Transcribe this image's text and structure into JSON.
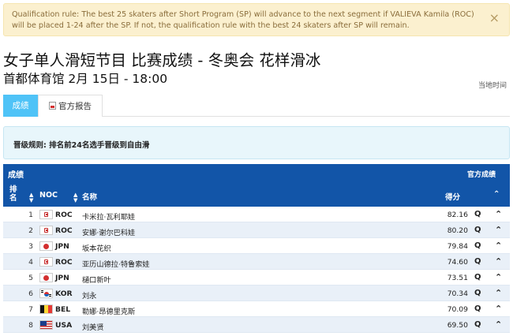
{
  "alert": {
    "text": "Qualification rule: The best 25 skaters after Short Program (SP) will advance to the next segment if VALIEVA Kamila (ROC) will be placed 1-24 after the SP. If not, the qualification rule with the best 24 skaters after SP will remain.",
    "close_label": "×"
  },
  "page": {
    "title": "女子单人滑短节目 比赛成绩 - 冬奥会 花样滑冰",
    "subtitle": "首都体育馆 2月 15日 - 18:00",
    "local_time": "当地时间"
  },
  "tabs": [
    {
      "label": "成绩",
      "active": true
    },
    {
      "label": "官方报告",
      "active": false
    }
  ],
  "qualification": {
    "text": "晋级规则: 排名前24名选手晋级到自由滑"
  },
  "results": {
    "section_title": "成绩",
    "official_report": "官方成绩",
    "columns": {
      "rank_line1": "排",
      "rank_line2": "名",
      "noc": "NOC",
      "name": "名称",
      "score": "得分",
      "sort_icon": "▲▼"
    },
    "rows": [
      {
        "rank": "1",
        "noc": "ROC",
        "flag": "roc",
        "name": "卡米拉·瓦利耶娃",
        "score": "82.16",
        "q": "Q"
      },
      {
        "rank": "2",
        "noc": "ROC",
        "flag": "roc",
        "name": "安娜·谢尔巴科娃",
        "score": "80.20",
        "q": "Q"
      },
      {
        "rank": "3",
        "noc": "JPN",
        "flag": "jpn",
        "name": "坂本花织",
        "score": "79.84",
        "q": "Q"
      },
      {
        "rank": "4",
        "noc": "ROC",
        "flag": "roc",
        "name": "亚历山德拉·特鲁索娃",
        "score": "74.60",
        "q": "Q"
      },
      {
        "rank": "5",
        "noc": "JPN",
        "flag": "jpn",
        "name": "樋口新叶",
        "score": "73.51",
        "q": "Q"
      },
      {
        "rank": "6",
        "noc": "KOR",
        "flag": "kor",
        "name": "刘永",
        "score": "70.34",
        "q": "Q"
      },
      {
        "rank": "7",
        "noc": "BEL",
        "flag": "bel",
        "name": "勒娜·昂德里克斯",
        "score": "70.09",
        "q": "Q"
      },
      {
        "rank": "8",
        "noc": "USA",
        "flag": "usa",
        "name": "刘美贤",
        "score": "69.50",
        "q": "Q"
      }
    ]
  },
  "colors": {
    "header_blue": "#1255a8",
    "tab_active": "#4fc3f7",
    "alert_bg": "#fbf0cf",
    "info_bg": "#e8f6fb"
  }
}
